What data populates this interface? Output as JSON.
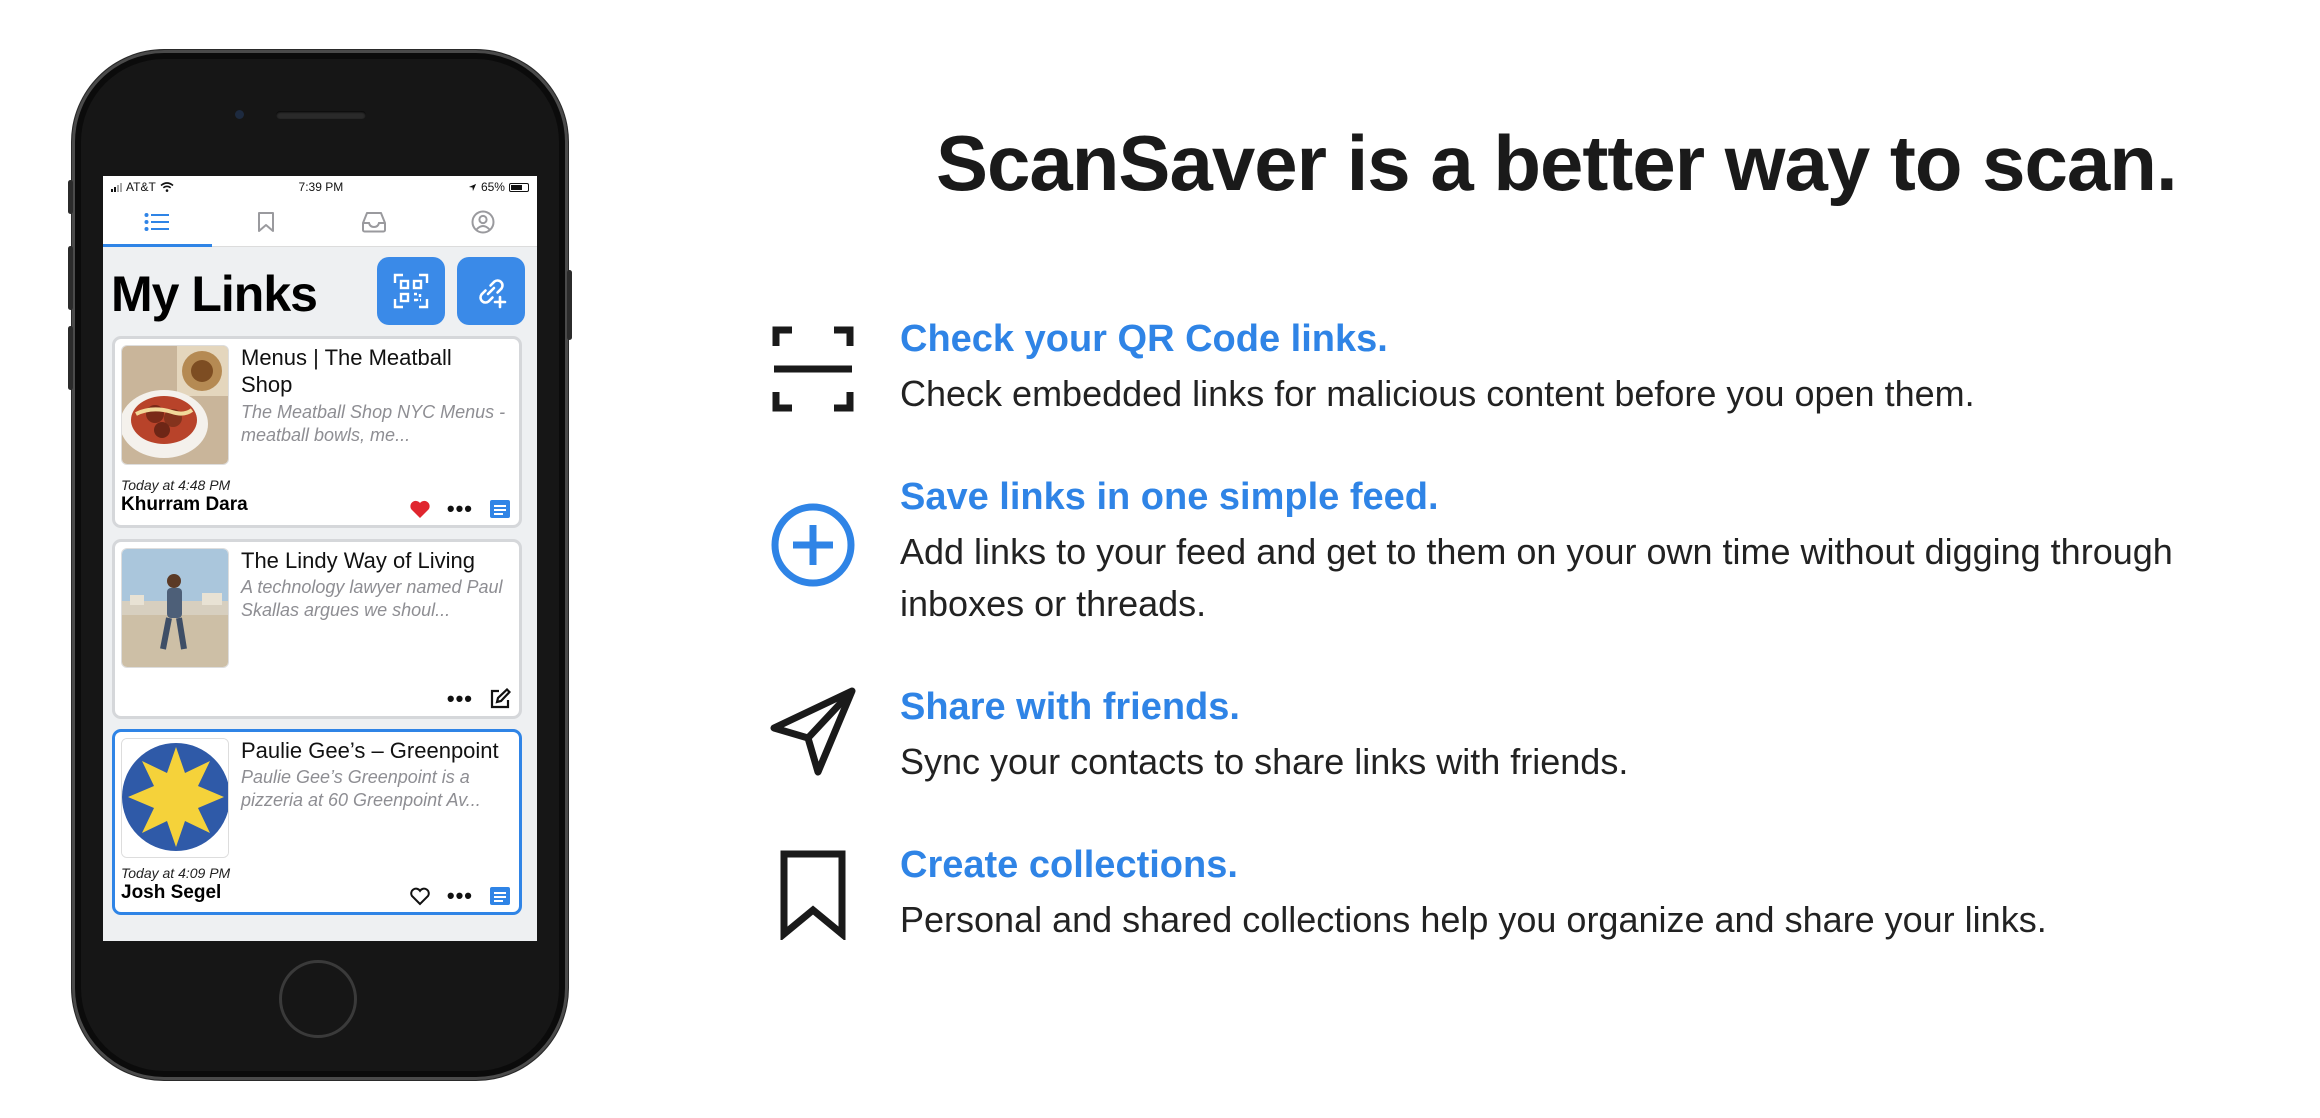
{
  "colors": {
    "accent": "#2f84e6",
    "heading": "#1a1a1a",
    "phone_body": "#161616",
    "liked_heart": "#e0262f"
  },
  "phone": {
    "status": {
      "carrier": "AT&T",
      "time": "7:39 PM",
      "battery": "65%"
    },
    "tabs": [
      {
        "icon": "list-icon",
        "active": true
      },
      {
        "icon": "bookmark-icon",
        "active": false
      },
      {
        "icon": "inbox-icon",
        "active": false
      },
      {
        "icon": "profile-icon",
        "active": false
      }
    ],
    "title": "My Links",
    "header_buttons": [
      "qr-scan-icon",
      "add-link-icon"
    ],
    "cards": [
      {
        "title": "Menus | The Meatball Shop",
        "description": "The Meatball Shop NYC Menus - meatball bowls, me...",
        "time": "Today at 4:48 PM",
        "author": "Khurram Dara",
        "liked": true,
        "actions": [
          "heart-icon",
          "more-icon",
          "feed-icon"
        ]
      },
      {
        "title": "The Lindy Way of Living",
        "description": "A technology lawyer named Paul Skallas argues we shoul...",
        "time": "",
        "author": "",
        "liked": false,
        "actions": [
          "more-icon",
          "edit-icon"
        ]
      },
      {
        "title": "Paulie Gee’s – Greenpoint",
        "description": "Paulie Gee’s Greenpoint is a pizzeria at 60 Greenpoint Av...",
        "time": "Today at 4:09 PM",
        "author": "Josh Segel",
        "liked": false,
        "actions": [
          "heart-outline-icon",
          "more-icon",
          "feed-icon"
        ]
      }
    ]
  },
  "headline": "ScanSaver is a better way to scan.",
  "features": [
    {
      "icon": "qr-scan-frame-icon",
      "title": "Check your QR Code links.",
      "description": "Check embedded links for malicious content before you open them."
    },
    {
      "icon": "plus-circle-icon",
      "title": "Save links in one simple feed.",
      "description": "Add links to your feed and get to them on your own time without digging through inboxes or threads."
    },
    {
      "icon": "send-icon",
      "title": "Share with friends.",
      "description": "Sync your contacts to share links with friends."
    },
    {
      "icon": "bookmark-icon",
      "title": "Create collections.",
      "description": "Personal and shared collections help you organize and share your links."
    }
  ]
}
